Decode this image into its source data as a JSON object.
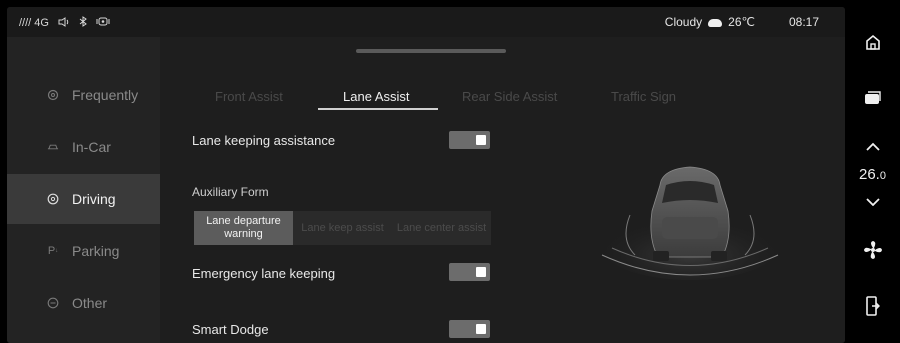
{
  "status_bar": {
    "signal": "////",
    "network": "4G",
    "weather": "Cloudy",
    "temperature": "26℃",
    "time": "08:17"
  },
  "nav": {
    "items": [
      {
        "label": "Frequently",
        "icon": "gear-icon",
        "active": false
      },
      {
        "label": "In-Car",
        "icon": "car-outline-icon",
        "active": false
      },
      {
        "label": "Driving",
        "icon": "steering-wheel-icon",
        "active": true
      },
      {
        "label": "Parking",
        "icon": "parking-icon",
        "active": false
      },
      {
        "label": "Other",
        "icon": "more-icon",
        "active": false
      }
    ]
  },
  "tabs": [
    {
      "label": "Front Assist",
      "active": false
    },
    {
      "label": "Lane Assist",
      "active": true
    },
    {
      "label": "Rear Side Assist",
      "active": false
    },
    {
      "label": "Traffic Sign",
      "active": false
    }
  ],
  "settings": {
    "lane_keeping": {
      "label": "Lane keeping assistance",
      "enabled": true
    },
    "auxiliary_form": {
      "label": "Auxiliary Form",
      "options": [
        "Lane departure warning",
        "Lane keep assist",
        "Lane center assist"
      ],
      "selected": "Lane departure warning"
    },
    "emergency_lane": {
      "label": "Emergency lane keeping",
      "enabled": true
    },
    "smart_dodge": {
      "label": "Smart Dodge",
      "enabled": true
    }
  },
  "dock": {
    "temperature": "26.",
    "temperature_decimal": "0"
  },
  "colors": {
    "background": "#1e1e1e",
    "nav_active": "#3a3a3a",
    "toggle_on": "#6c6c6c",
    "text": "#e8e8e8"
  }
}
